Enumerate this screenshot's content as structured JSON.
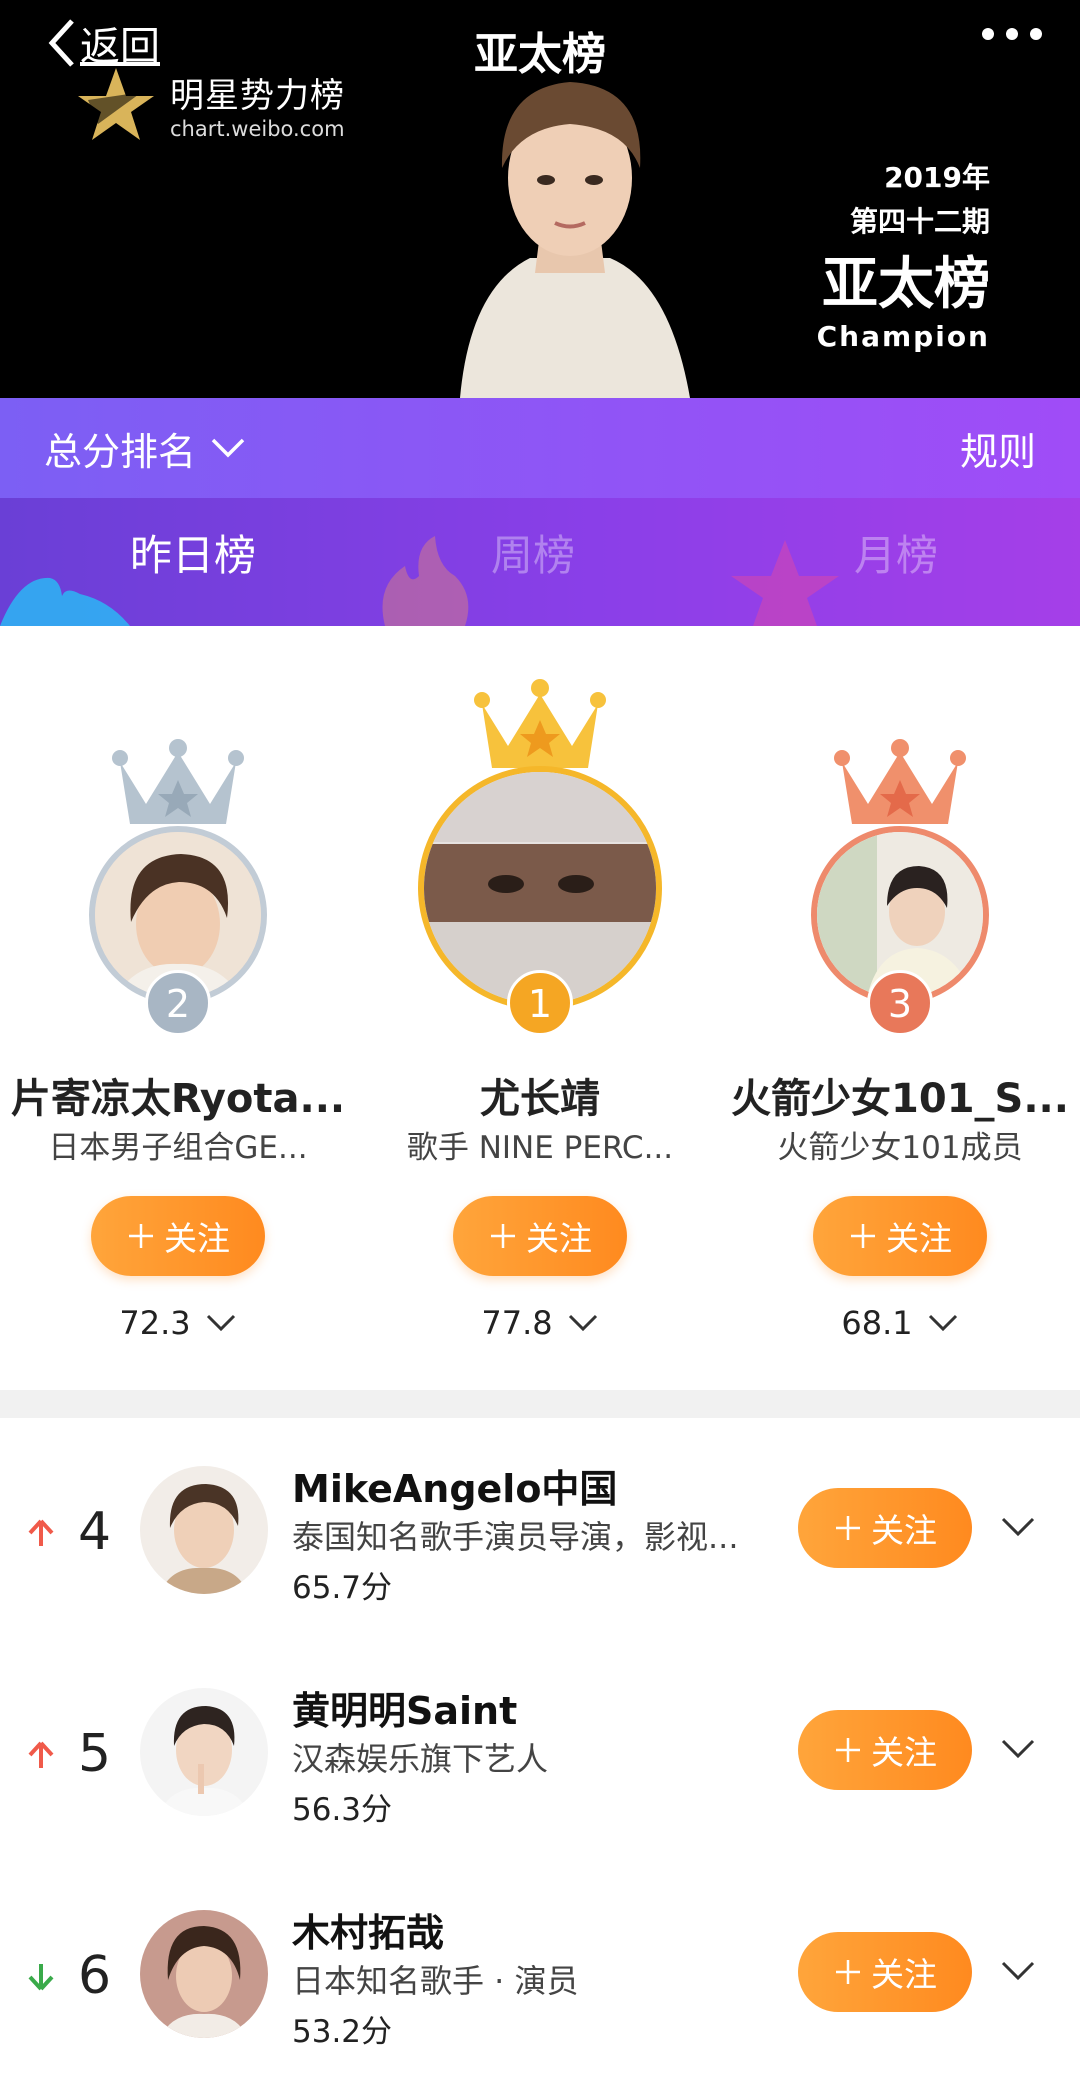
{
  "header": {
    "title": "亚太榜",
    "back_label": "返回",
    "logo_title": "明星势力榜",
    "logo_url": "chart.weibo.com",
    "stamp_year": "2019年",
    "stamp_issue": "第四十二期",
    "stamp_title": "亚太榜",
    "stamp_sub": "Champion"
  },
  "filter": {
    "sort_label": "总分排名",
    "rules_label": "规则"
  },
  "tabs": [
    {
      "label": "昨日榜",
      "active": true
    },
    {
      "label": "周榜",
      "active": false
    },
    {
      "label": "月榜",
      "active": false
    }
  ],
  "podium": [
    {
      "rank": "2",
      "name": "片寄凉太Ryota...",
      "desc": "日本男子组合GE...",
      "follow": "关注",
      "score": "72.3"
    },
    {
      "rank": "1",
      "name": "尤长靖",
      "desc": "歌手 NINE PERC...",
      "follow": "关注",
      "score": "77.8"
    },
    {
      "rank": "3",
      "name": "火箭少女101_S...",
      "desc": "火箭少女101成员",
      "follow": "关注",
      "score": "68.1"
    }
  ],
  "list": [
    {
      "rank": "4",
      "trend": "up",
      "name": "MikeAngelo中国",
      "desc": "泰国知名歌手演员导演，影视...",
      "score": "65.7分",
      "follow": "关注"
    },
    {
      "rank": "5",
      "trend": "up",
      "name": "黄明明Saint",
      "desc": "汉森娱乐旗下艺人",
      "score": "56.3分",
      "follow": "关注"
    },
    {
      "rank": "6",
      "trend": "down",
      "name": "木村拓哉",
      "desc": "日本知名歌手 · 演员",
      "score": "53.2分",
      "follow": "关注"
    }
  ],
  "colors": {
    "accent_orange": "#ff9a2e",
    "gold": "#f5b72a",
    "silver": "#aab7c4",
    "bronze": "#ee8a6c",
    "trend_up": "#f05a4a",
    "trend_down": "#3aaa4a"
  }
}
